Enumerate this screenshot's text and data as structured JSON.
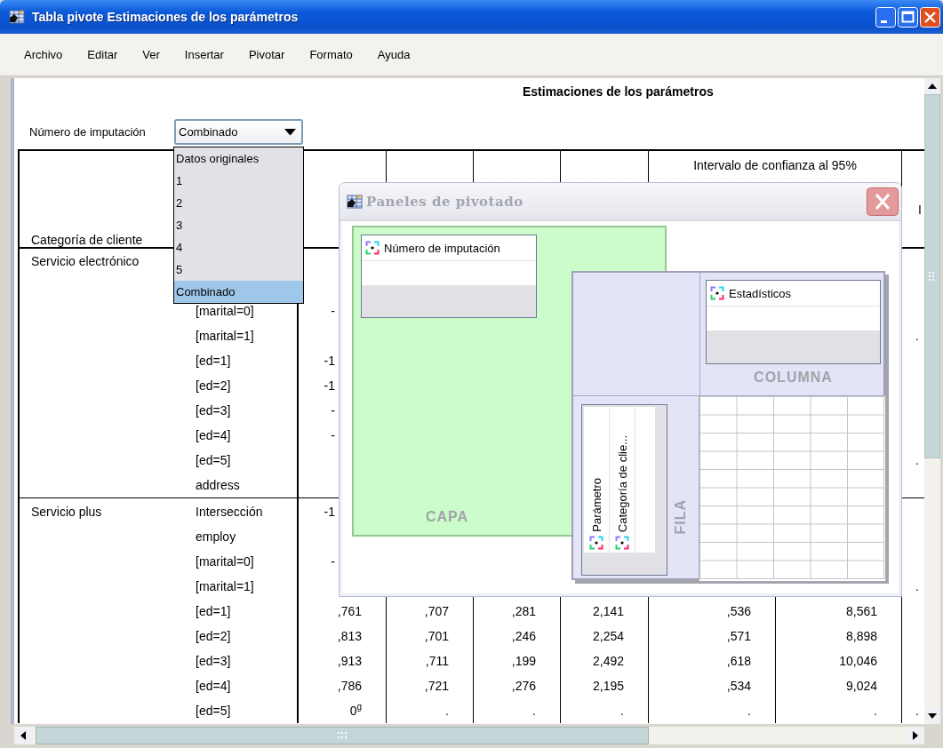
{
  "window": {
    "title": "Tabla pivote Estimaciones de los parámetros"
  },
  "menu": [
    "Archivo",
    "Editar",
    "Ver",
    "Insertar",
    "Pivotar",
    "Formato",
    "Ayuda"
  ],
  "table_title": "Estimaciones de los parámetros",
  "layer": {
    "label": "Número de imputación",
    "value": "Combinado",
    "options": [
      {
        "label": "Datos originales",
        "selected": false
      },
      {
        "label": "1",
        "selected": false
      },
      {
        "label": "2",
        "selected": false
      },
      {
        "label": "3",
        "selected": false
      },
      {
        "label": "4",
        "selected": false
      },
      {
        "label": "5",
        "selected": false
      },
      {
        "label": "Combinado",
        "selected": true
      }
    ]
  },
  "table": {
    "row_header": "Categoría de cliente",
    "ci_header": "Intervalo de confianza al 95%",
    "column_7_header": "I",
    "rows": [
      {
        "category": "Servicio electrónico"
      },
      {},
      {
        "parameter": "[marital=0]",
        "column_1_visible": "-"
      },
      {
        "parameter": "[marital=1]",
        "edge": "."
      },
      {
        "parameter": "[ed=1]",
        "column_1_visible": "-1"
      },
      {
        "parameter": "[ed=2]",
        "column_1_visible": "-1"
      },
      {
        "parameter": "[ed=3]",
        "column_1_visible": "-"
      },
      {
        "parameter": "[ed=4]",
        "column_1_visible": "-"
      },
      {
        "parameter": "[ed=5]",
        "edge": "."
      },
      {
        "parameter": "address"
      },
      {
        "category": "Servicio plus",
        "parameter": "Intersección",
        "column_1_visible": "-1"
      },
      {
        "parameter": "employ"
      },
      {
        "parameter": "[marital=0]",
        "column_1_visible": "-"
      },
      {
        "parameter": "[marital=1]",
        "edge": "."
      },
      {
        "parameter": "[ed=1]",
        "values": [
          ",761",
          ",707",
          ",281",
          "2,141",
          ",536",
          "8,561"
        ]
      },
      {
        "parameter": "[ed=2]",
        "values": [
          ",813",
          ",701",
          ",246",
          "2,254",
          ",571",
          "8,898"
        ]
      },
      {
        "parameter": "[ed=3]",
        "values": [
          ",913",
          ",711",
          ",199",
          "2,492",
          ",618",
          "10,046"
        ]
      },
      {
        "parameter": "[ed=4]",
        "values": [
          ",786",
          ",721",
          ",276",
          "2,195",
          ",534",
          "9,024"
        ]
      },
      {
        "parameter": "[ed=5]",
        "values": [
          "0$^{g}$",
          ".",
          ".",
          ".",
          ".",
          ".",
          "."
        ]
      }
    ]
  },
  "pivot_panels": {
    "title": "Paneles de pivotado",
    "layer": {
      "label": "CAPA",
      "items": [
        "Número de imputación"
      ]
    },
    "column": {
      "label": "COLUMNA",
      "items": [
        "Estadísticos"
      ]
    },
    "row": {
      "label": "FILA",
      "items": [
        "Parámetro",
        "Categoría de clie..."
      ]
    }
  }
}
